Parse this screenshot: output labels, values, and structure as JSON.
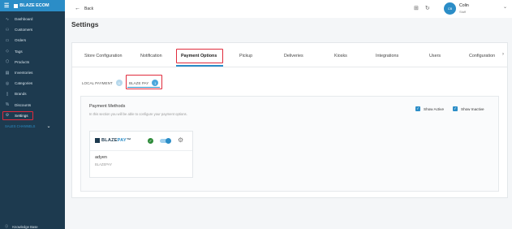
{
  "sidebar": {
    "brand": "BLAZE ECOM",
    "items": [
      {
        "label": "Dashboard",
        "icon": "pulse-icon"
      },
      {
        "label": "Customers",
        "icon": "users-icon"
      },
      {
        "label": "Orders",
        "icon": "orders-icon"
      },
      {
        "label": "Tags",
        "icon": "tag-icon"
      },
      {
        "label": "Products",
        "icon": "box-icon"
      },
      {
        "label": "Inventories",
        "icon": "inventory-icon"
      },
      {
        "label": "Categories",
        "icon": "categories-icon"
      },
      {
        "label": "Brands",
        "icon": "brands-icon"
      },
      {
        "label": "Discounts",
        "icon": "discount-icon"
      },
      {
        "label": "Settings",
        "icon": "gear-icon"
      }
    ],
    "sales_channels": "SALES CHANNELS",
    "knowledge_base": "Knowledge Base"
  },
  "topbar": {
    "back_label": "Back",
    "avatar_initials": "CB",
    "user_name": "Colin",
    "user_role": "Staff"
  },
  "page": {
    "title": "Settings"
  },
  "tabs": [
    "Store Configuration",
    "Notification",
    "Payment Options",
    "Pickup",
    "Deliveries",
    "Kiosks",
    "Integrations",
    "Users",
    "Configuration"
  ],
  "active_tab": "Payment Options",
  "subtabs": [
    {
      "label": "LOCAL PAYMENT",
      "count": "0"
    },
    {
      "label": "BLAZE PAY",
      "count": "1"
    }
  ],
  "payment_methods": {
    "title": "Payment Methods",
    "description": "In this section you will be able to configure your payment options.",
    "show_active": "Show Active",
    "show_inactive": "Show Inactive",
    "card": {
      "logo_text_1": "BLAZE",
      "logo_text_2": "PAY",
      "name": "adyen",
      "provider": "BLAZEPAY"
    }
  },
  "colors": {
    "sidebar_bg": "#1d3a4f",
    "accent": "#2b8dc7",
    "highlight_box": "#e02b3c",
    "success": "#2e8b3a"
  }
}
